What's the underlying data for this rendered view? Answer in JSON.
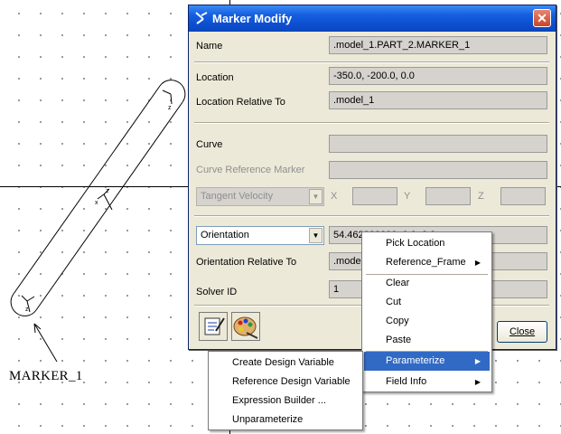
{
  "canvas": {
    "marker_label": "MARKER_1"
  },
  "dialog": {
    "title": "Marker Modify",
    "name_label": "Name",
    "name_value": ".model_1.PART_2.MARKER_1",
    "location_label": "Location",
    "location_value": "-350.0, -200.0, 0.0",
    "loc_rel_label": "Location Relative To",
    "loc_rel_value": ".model_1",
    "curve_label": "Curve",
    "curve_value": "",
    "curve_ref_label": "Curve Reference Marker",
    "curve_ref_value": "",
    "tangent_select": "Tangent Velocity",
    "axis_x": "X",
    "axis_y": "Y",
    "axis_z": "Z",
    "orientation_select": "Orientation",
    "orientation_value": "54.462000000, 0.0, 0.0",
    "ori_rel_label": "Orientation Relative To",
    "ori_rel_value": ".model_1",
    "solver_label": "Solver ID",
    "solver_value": "1",
    "close_label": "Close"
  },
  "context_menu": {
    "items": [
      "Pick Location",
      "Reference_Frame",
      "Clear",
      "Cut",
      "Copy",
      "Paste",
      "Parameterize",
      "Field Info"
    ]
  },
  "submenu": {
    "items": [
      "Create Design Variable",
      "Reference Design Variable",
      "Expression Builder ...",
      "Unparameterize"
    ]
  },
  "colors": {
    "title_bar": "#0c4fd0",
    "highlight": "#316ac5",
    "dialog_bg": "#ece9d8"
  }
}
